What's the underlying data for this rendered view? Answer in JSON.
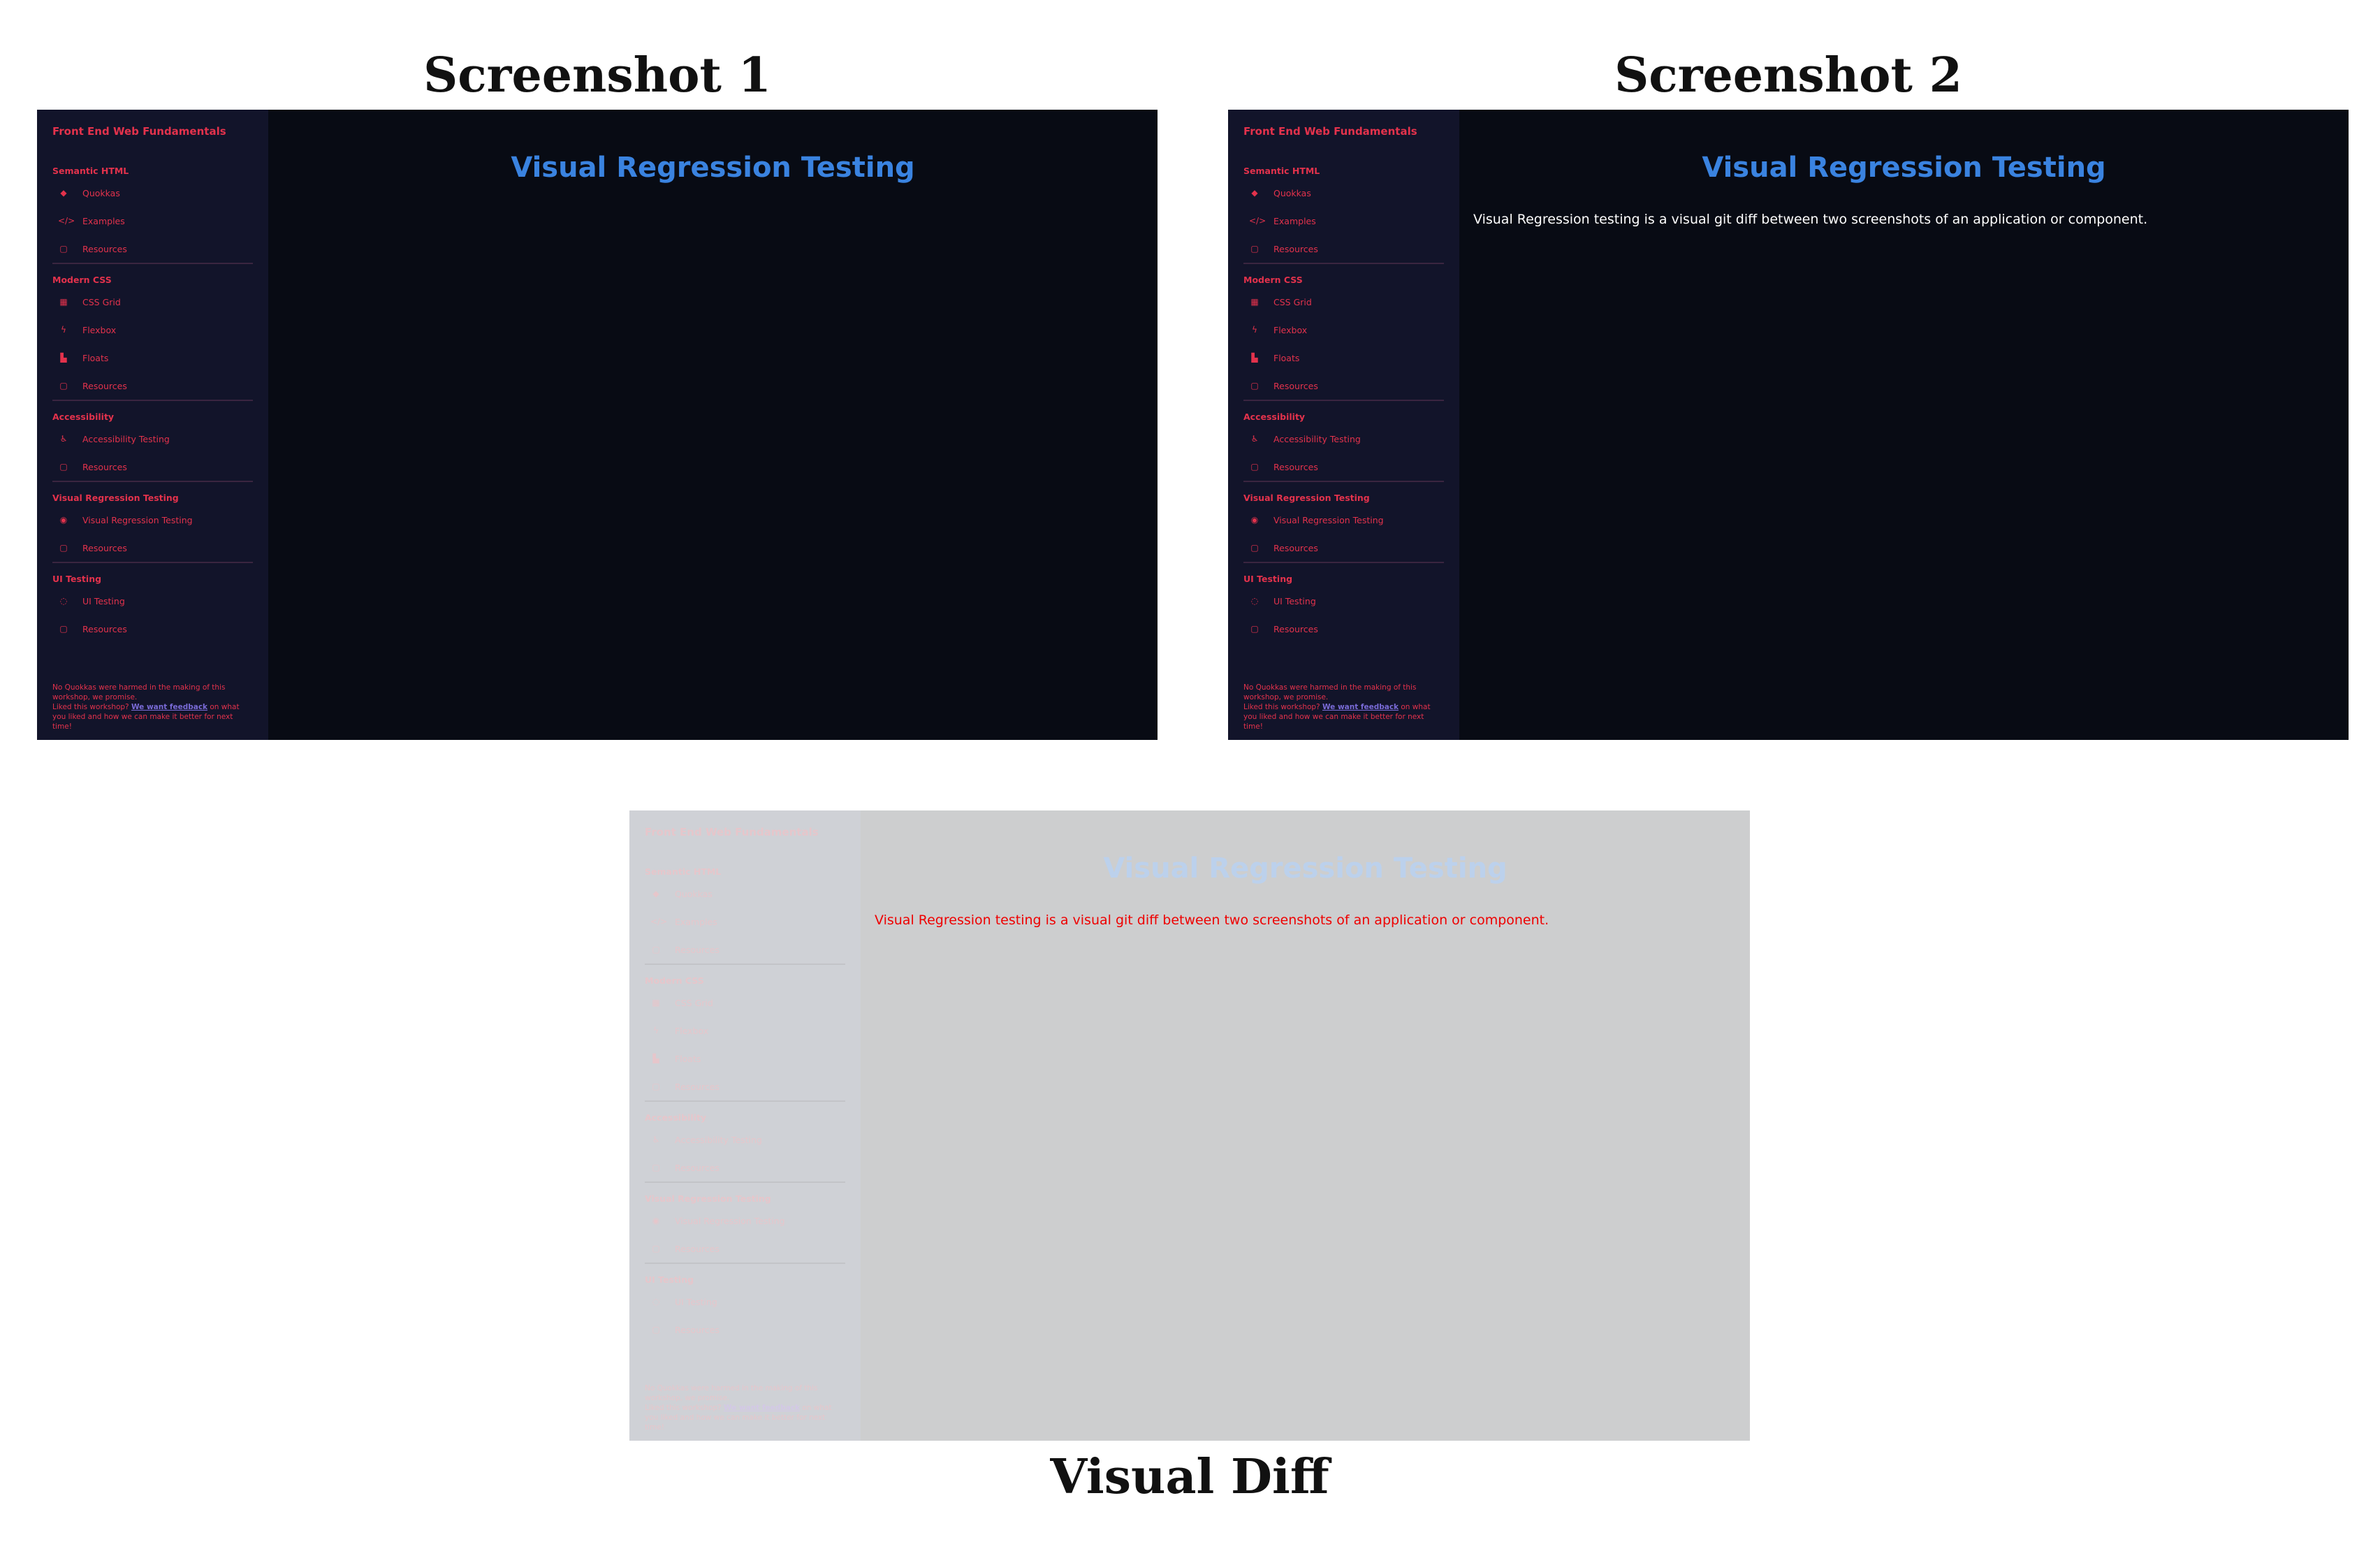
{
  "captions": {
    "screenshot1": "Screenshot 1",
    "screenshot2": "Screenshot 2",
    "diff": "Visual Diff"
  },
  "site_title": "Front End Web Fundamentals",
  "sidebar": {
    "sections": [
      {
        "title": "Semantic HTML",
        "items": [
          {
            "label": "Quokkas",
            "icon": "quokka-icon"
          },
          {
            "label": "Examples",
            "icon": "code-icon"
          },
          {
            "label": "Resources",
            "icon": "book-icon"
          }
        ]
      },
      {
        "title": "Modern CSS",
        "items": [
          {
            "label": "CSS Grid",
            "icon": "grid-icon"
          },
          {
            "label": "Flexbox",
            "icon": "flex-icon"
          },
          {
            "label": "Floats",
            "icon": "float-icon"
          },
          {
            "label": "Resources",
            "icon": "book-icon"
          }
        ]
      },
      {
        "title": "Accessibility",
        "items": [
          {
            "label": "Accessibility Testing",
            "icon": "accessibility-icon"
          },
          {
            "label": "Resources",
            "icon": "book-icon"
          }
        ]
      },
      {
        "title": "Visual Regression Testing",
        "items": [
          {
            "label": "Visual Regression Testing",
            "icon": "eye-icon"
          },
          {
            "label": "Resources",
            "icon": "book-icon"
          }
        ]
      },
      {
        "title": "UI Testing",
        "items": [
          {
            "label": "UI Testing",
            "icon": "chat-icon"
          },
          {
            "label": "Resources",
            "icon": "book-icon"
          }
        ]
      }
    ]
  },
  "footer": {
    "line1": "No Quokkas were harmed in the making of this workshop, we promise.",
    "line2_prefix": "Liked this workshop? ",
    "link": "We want feedback",
    "line2_suffix": " on what you liked and how we can make it better for next time!"
  },
  "main": {
    "heading": "Visual Regression Testing",
    "paragraph": "Visual Regression testing is a visual git diff between two screenshots of an application or component."
  },
  "colors": {
    "accent_red": "#e3324c",
    "heading_blue": "#3a83e0",
    "sidebar_bg": "#12142a",
    "main_bg": "#080b14",
    "diff_highlight": "#ee0000"
  }
}
